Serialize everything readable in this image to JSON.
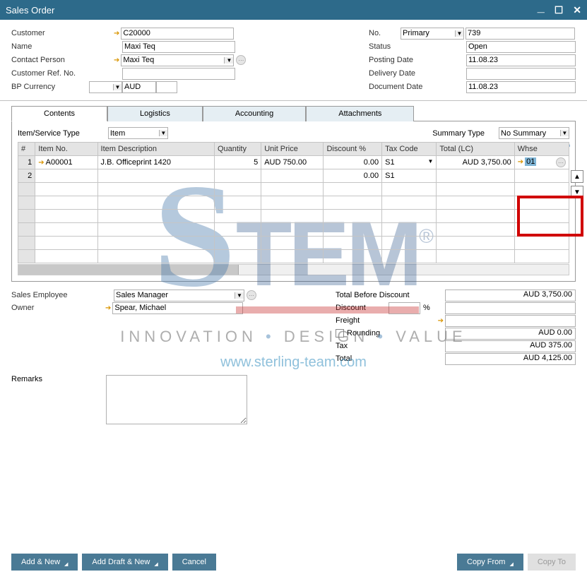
{
  "window": {
    "title": "Sales Order"
  },
  "header": {
    "left": {
      "customer_lbl": "Customer",
      "customer_val": "C20000",
      "name_lbl": "Name",
      "name_val": "Maxi Teq",
      "contact_lbl": "Contact Person",
      "contact_val": "Maxi Teq",
      "custref_lbl": "Customer Ref. No.",
      "custref_val": "",
      "bpcurr_lbl": "BP Currency",
      "bpcurr_val": "AUD"
    },
    "right": {
      "no_lbl": "No.",
      "no_type": "Primary",
      "no_val": "739",
      "status_lbl": "Status",
      "status_val": "Open",
      "postdate_lbl": "Posting Date",
      "postdate_val": "11.08.23",
      "deldate_lbl": "Delivery Date",
      "deldate_val": "",
      "docdate_lbl": "Document Date",
      "docdate_val": "11.08.23"
    }
  },
  "tabs": {
    "t1": "Contents",
    "t2": "Logistics",
    "t3": "Accounting",
    "t4": "Attachments"
  },
  "subhead": {
    "itype_lbl": "Item/Service Type",
    "itype_val": "Item",
    "sumtype_lbl": "Summary Type",
    "sumtype_val": "No Summary"
  },
  "grid": {
    "cols": {
      "num": "#",
      "itemno": "Item No.",
      "desc": "Item Description",
      "qty": "Quantity",
      "uprice": "Unit Price",
      "disc": "Discount %",
      "taxc": "Tax Code",
      "total": "Total (LC)",
      "whse": "Whse"
    },
    "rows": [
      {
        "n": "1",
        "itemno": "A00001",
        "desc": "J.B. Officeprint 1420",
        "qty": "5",
        "uprice": "AUD 750.00",
        "disc": "0.00",
        "taxc": "S1",
        "total": "AUD 3,750.00",
        "whse": "01"
      },
      {
        "n": "2",
        "itemno": "",
        "desc": "",
        "qty": "",
        "uprice": "",
        "disc": "0.00",
        "taxc": "S1",
        "total": "",
        "whse": ""
      }
    ]
  },
  "footer": {
    "salesemp_lbl": "Sales Employee",
    "salesemp_val": "Sales Manager",
    "owner_lbl": "Owner",
    "owner_val": "Spear, Michael",
    "remarks_lbl": "Remarks"
  },
  "totals": {
    "tbd_lbl": "Total Before Discount",
    "tbd_val": "AUD 3,750.00",
    "disc_lbl": "Discount",
    "disc_pct": "",
    "disc_unit": "%",
    "disc_val": "",
    "freight_lbl": "Freight",
    "freight_val": "",
    "round_lbl": "Rounding",
    "round_val": "AUD 0.00",
    "tax_lbl": "Tax",
    "tax_val": "AUD 375.00",
    "total_lbl": "Total",
    "total_val": "AUD 4,125.00"
  },
  "buttons": {
    "addnew": "Add & New",
    "adddraft": "Add Draft & New",
    "cancel": "Cancel",
    "copyfrom": "Copy From",
    "copyto": "Copy To"
  },
  "watermark": {
    "s": "S",
    "tem": "TEM",
    "reg": "®",
    "tag_inno": "INNOVATION",
    "tag_design": "DESIGN",
    "tag_value": "VALUE",
    "url": "www.sterling-team.com"
  }
}
